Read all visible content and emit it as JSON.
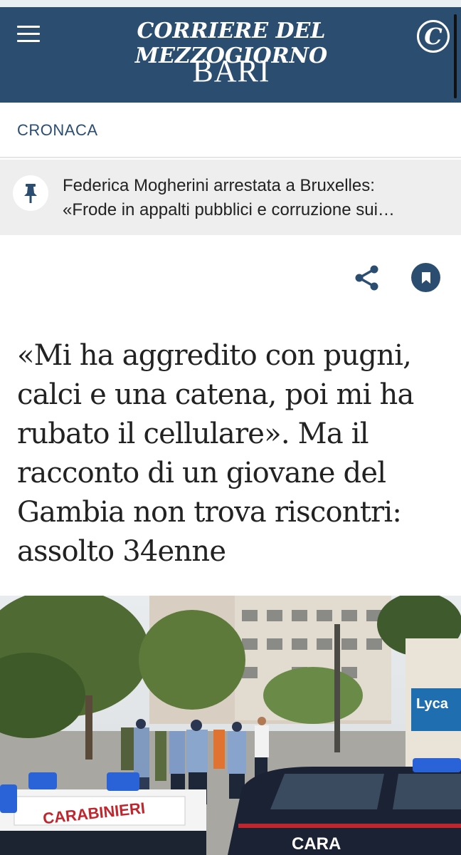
{
  "header": {
    "brand": "CORRIERE DEL MEZZOGIORNO",
    "city": "BARI",
    "logo_letter": "C",
    "menu_icon": "hamburger-menu-icon",
    "background": "#2b4e70"
  },
  "section": {
    "label": "CRONACA"
  },
  "breaking": {
    "icon": "pushpin-icon",
    "lines": [
      "Federica Mogherini arrestata a Bruxelles:",
      "«Frode in appalti pubblici e corruzione sui…"
    ]
  },
  "actions": {
    "share_icon": "share-icon",
    "bookmark_icon": "bookmark-icon"
  },
  "article": {
    "headline_lines": [
      "«Mi ha aggredito con pugni,",
      "calci e una catena, poi mi ha",
      "rubato il cellulare». Ma il",
      "racconto di un giovane del",
      "Gambia non trova riscontri:",
      "assolto 34enne"
    ],
    "photo_text": {
      "car_left": "CARABINIERI",
      "car_right": "CARA",
      "shop_sign": "Lyca"
    }
  },
  "colors": {
    "accent": "#2b4e70",
    "text": "#222222",
    "breaking_bg": "#eeeeee"
  }
}
